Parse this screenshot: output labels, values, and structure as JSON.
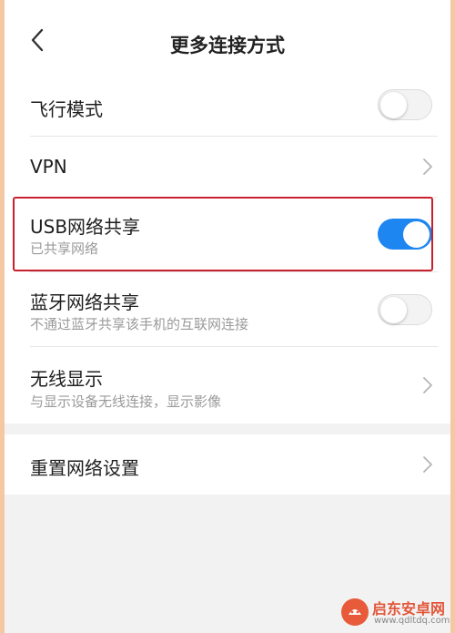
{
  "header": {
    "title": "更多连接方式",
    "back_icon": "chevron-left-icon"
  },
  "settings": {
    "airplane": {
      "label": "飞行模式",
      "toggle": "off"
    },
    "vpn": {
      "label": "VPN"
    },
    "usb_tethering": {
      "label": "USB网络共享",
      "subtitle": "已共享网络",
      "toggle": "on"
    },
    "bluetooth_tethering": {
      "label": "蓝牙网络共享",
      "subtitle": "不通过蓝牙共享该手机的互联网连接",
      "toggle": "off"
    },
    "wireless_display": {
      "label": "无线显示",
      "subtitle": "与显示设备无线连接，显示影像"
    },
    "reset_network": {
      "label": "重置网络设置"
    }
  },
  "colors": {
    "toggle_on": "#1e86f0",
    "highlight_border": "#c8202f",
    "outer_background": "#f5c8a4"
  },
  "watermark": {
    "brand": "启东安卓网",
    "url": "www.qdltdq.com"
  }
}
